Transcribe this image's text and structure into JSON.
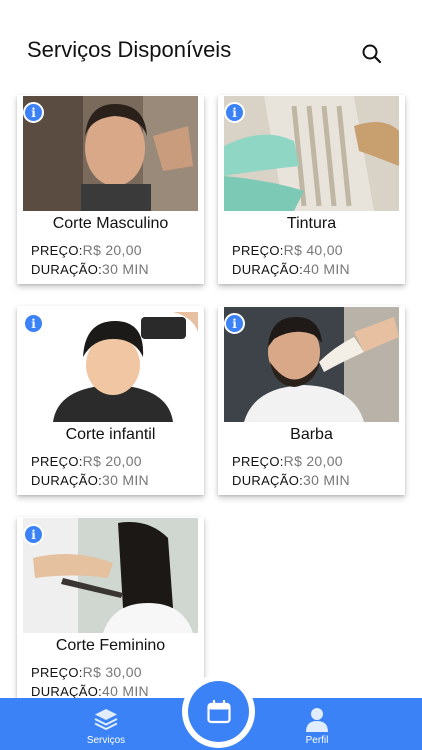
{
  "header": {
    "title": "Serviços Disponíveis",
    "search_icon": "search-icon"
  },
  "labels": {
    "price": "PREÇO:",
    "duration": "DURAÇÃO:"
  },
  "services": [
    {
      "name": "Corte Masculino",
      "price": "R$ 20,00",
      "duration": "30 MIN",
      "info_icon": "info-icon"
    },
    {
      "name": "Tintura",
      "price": "R$ 40,00",
      "duration": "40 MIN",
      "info_icon": "info-icon"
    },
    {
      "name": "Corte infantil",
      "price": "R$ 20,00",
      "duration": "30 MIN",
      "info_icon": "info-icon"
    },
    {
      "name": "Barba",
      "price": "R$ 20,00",
      "duration": "30 MIN",
      "info_icon": "info-icon"
    },
    {
      "name": "Corte Feminino",
      "price": "R$ 30,00",
      "duration": "40 MIN",
      "info_icon": "info-icon"
    }
  ],
  "bottom_nav": {
    "services_label": "Serviços",
    "services_icon": "layers-icon",
    "schedule_icon": "calendar-icon",
    "profile_label": "Perfil",
    "profile_icon": "user-icon"
  },
  "colors": {
    "accent": "#3b82f6",
    "value_text": "#777777"
  }
}
